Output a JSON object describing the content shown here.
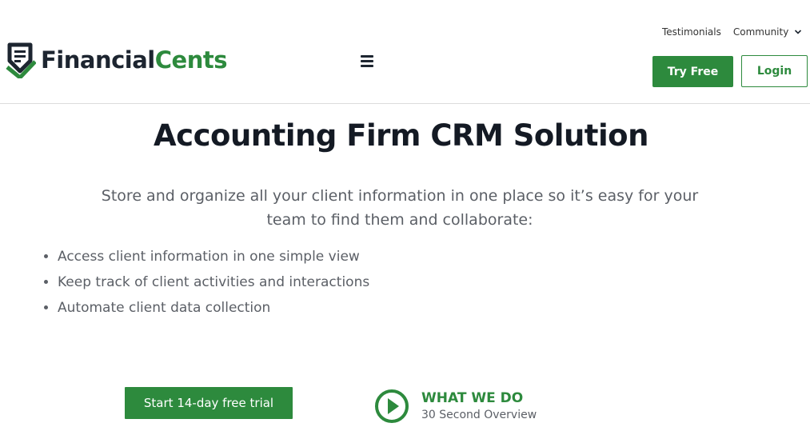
{
  "header": {
    "logo": {
      "part1": "Financial",
      "part2": "Cents",
      "icon": "financialcents-logo-icon"
    },
    "menu_icon": "hamburger-menu-icon",
    "top_links": [
      {
        "label": "Testimonials"
      },
      {
        "label": "Community",
        "icon": "chevron-down-icon"
      }
    ],
    "try_free_label": "Try Free",
    "login_label": "Login"
  },
  "hero": {
    "title": "Accounting Firm CRM Solution",
    "subtitle": "Store and organize all your client information in one place so it’s easy for your team to find them and collaborate:",
    "bullets": [
      "Access client information in one simple view",
      "Keep track of client activities and interactions",
      "Automate client data collection"
    ],
    "cta_label": "Start 14-day free trial",
    "video": {
      "title": "WHAT WE DO",
      "subtitle": "30 Second Overview",
      "icon": "play-circle-icon"
    }
  },
  "colors": {
    "brand_green": "#2d8a3d",
    "dark": "#1d2530",
    "body_text": "#5b5f66"
  }
}
